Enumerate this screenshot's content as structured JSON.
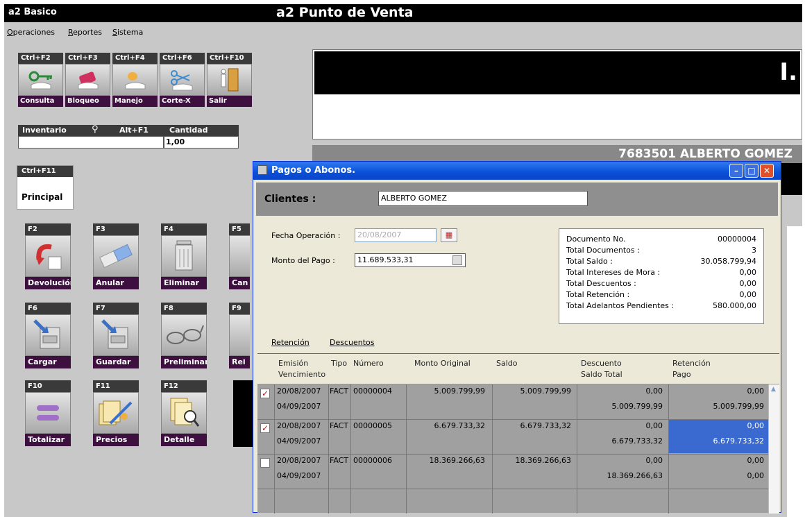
{
  "app": {
    "name": "a2 Basico",
    "title": "a2 Punto de Venta"
  },
  "menu": [
    "Operaciones",
    "Reportes",
    "Sistema"
  ],
  "toolbar": [
    {
      "key": "Ctrl+F2",
      "label": "Consulta",
      "icon": "key-icon"
    },
    {
      "key": "Ctrl+F3",
      "label": "Bloqueo",
      "icon": "lock-icon"
    },
    {
      "key": "Ctrl+F4",
      "label": "Manejo",
      "icon": "hand-icon"
    },
    {
      "key": "Ctrl+F6",
      "label": "Corte-X",
      "icon": "scissors-icon"
    },
    {
      "key": "Ctrl+F10",
      "label": "Salir",
      "icon": "exit-door-icon"
    }
  ],
  "inventory": {
    "label": "Inventario",
    "shortcut": "Alt+F1",
    "qty_label": "Cantidad",
    "qty_value": "1,00"
  },
  "principal_tab": {
    "key": "Ctrl+F11",
    "label": "Principal"
  },
  "function_buttons": [
    {
      "key": "F2",
      "label": "Devolución",
      "icon": "return-arrow-icon"
    },
    {
      "key": "F3",
      "label": "Anular",
      "icon": "eraser-icon"
    },
    {
      "key": "F4",
      "label": "Eliminar",
      "icon": "trash-icon"
    },
    {
      "key": "F5",
      "label": "Can",
      "icon": "box-icon"
    },
    {
      "key": "F6",
      "label": "Cargar",
      "icon": "cabinet-load-icon"
    },
    {
      "key": "F7",
      "label": "Guardar",
      "icon": "cabinet-save-icon"
    },
    {
      "key": "F8",
      "label": "Preliminar",
      "icon": "glasses-icon"
    },
    {
      "key": "F9",
      "label": "Rei",
      "icon": "box-icon"
    },
    {
      "key": "F10",
      "label": "Totalizar",
      "icon": "equals-icon"
    },
    {
      "key": "F11",
      "label": "Precios",
      "icon": "price-tags-icon"
    },
    {
      "key": "F12",
      "label": "Detalle",
      "icon": "document-magnifier-icon"
    }
  ],
  "display": {
    "total_glyph": "I.",
    "customer": "7683501 ALBERTO GOMEZ"
  },
  "dialog": {
    "title": "Pagos o Abonos.",
    "clientes_label": "Clientes  :",
    "client_name": "ALBERTO GOMEZ",
    "fecha_label": "Fecha Operación :",
    "fecha_value": "20/08/2007",
    "monto_label": "Monto del Pago :",
    "monto_value": "11.689.533,31",
    "summary": [
      {
        "label": "Documento No.",
        "value": "00000004"
      },
      {
        "label": "Total Documentos :",
        "value": "3"
      },
      {
        "label": "Total Saldo :",
        "value": "30.058.799,94"
      },
      {
        "label": "Total Intereses de Mora :",
        "value": "0,00"
      },
      {
        "label": "Total Descuentos :",
        "value": "0,00"
      },
      {
        "label": "Total Retención  :",
        "value": "0,00"
      },
      {
        "label": "Total Adelantos Pendientes :",
        "value": "580.000,00"
      }
    ],
    "tabs": [
      "Retención",
      "Descuentos"
    ],
    "columns": {
      "emision": "Emisión",
      "vencimiento": "Vencimiento",
      "tipo": "Tipo",
      "numero": "Número",
      "monto": "Monto Original",
      "saldo": "Saldo",
      "descuento": "Descuento",
      "saldo_total": "Saldo Total",
      "retencion": "Retención",
      "pago": "Pago"
    },
    "rows": [
      {
        "checked": true,
        "emision": "20/08/2007",
        "vencimiento": "04/09/2007",
        "tipo": "FACT",
        "numero": "00000004",
        "monto": "5.009.799,99",
        "saldo": "5.009.799,99",
        "descuento": "0,00",
        "saldo_total": "5.009.799,99",
        "retencion": "0,00",
        "pago": "5.009.799,99",
        "selected": false
      },
      {
        "checked": true,
        "emision": "20/08/2007",
        "vencimiento": "04/09/2007",
        "tipo": "FACT",
        "numero": "00000005",
        "monto": "6.679.733,32",
        "saldo": "6.679.733,32",
        "descuento": "0,00",
        "saldo_total": "6.679.733,32",
        "retencion": "0,00",
        "pago": "6.679.733,32",
        "selected": true
      },
      {
        "checked": false,
        "emision": "20/08/2007",
        "vencimiento": "04/09/2007",
        "tipo": "FACT",
        "numero": "00000006",
        "monto": "18.369.266,63",
        "saldo": "18.369.266,63",
        "descuento": "0,00",
        "saldo_total": "18.369.266,63",
        "retencion": "0,00",
        "pago": "0,00",
        "selected": false
      }
    ]
  }
}
